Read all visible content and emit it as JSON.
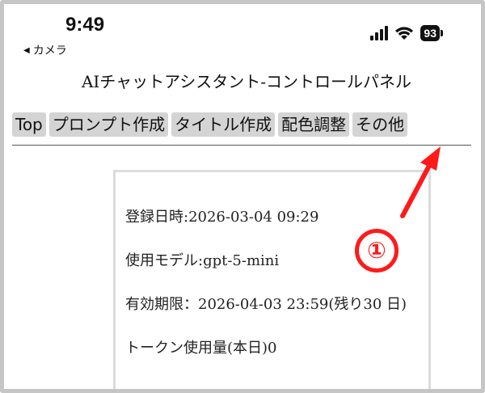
{
  "status_bar": {
    "time": "9:49",
    "back_label": "カメラ",
    "battery": "93"
  },
  "page": {
    "title": "AIチャットアシスタント-コントロールパネル"
  },
  "nav": {
    "items": [
      {
        "label": "Top"
      },
      {
        "label": "プロンプト作成"
      },
      {
        "label": "タイトル作成"
      },
      {
        "label": "配色調整"
      },
      {
        "label": "その他"
      }
    ]
  },
  "info": {
    "registered": "登録日時:2026-03-04 09:29",
    "model": "使用モデル:gpt-5-mini",
    "expiry": "有効期限：2026-04-03 23:59(残り30 日)",
    "tokens": "トークン使用量(本日)0"
  },
  "annotation": {
    "number": "①",
    "color": "#ff1a1a"
  }
}
